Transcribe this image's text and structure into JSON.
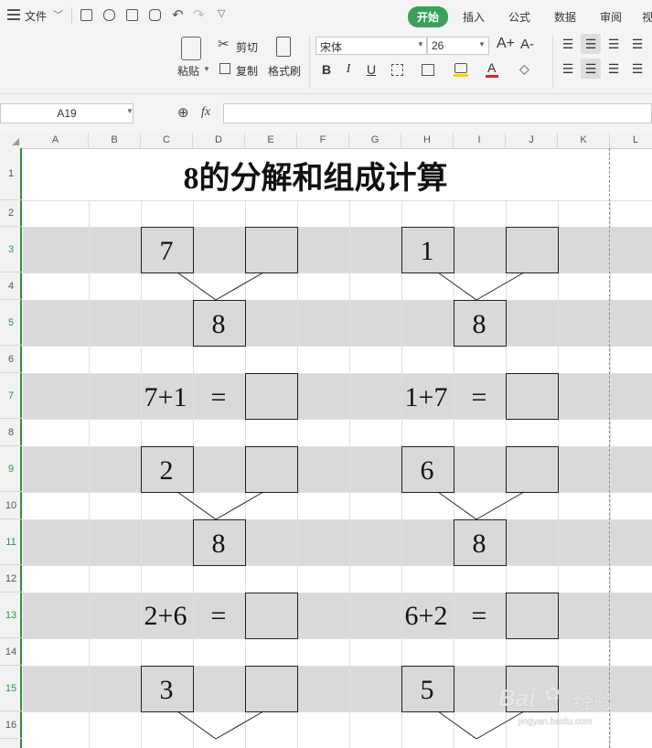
{
  "menu": {
    "file": "文件"
  },
  "tabs": {
    "home": "开始",
    "insert": "插入",
    "formula": "公式",
    "data": "数据",
    "review": "审阅",
    "view": "视"
  },
  "ribbon": {
    "paste": "粘贴",
    "cut": "剪切",
    "copy": "复制",
    "format_painter": "格式刷",
    "font_name": "宋体",
    "font_size": "26",
    "bold": "B",
    "italic": "I",
    "underline": "U",
    "grow_font": "A+",
    "shrink_font": "A-",
    "font_color_glyph": "A"
  },
  "formula_bar": {
    "cell_ref": "A19",
    "fx": "fx"
  },
  "columns": [
    "A",
    "B",
    "C",
    "D",
    "E",
    "F",
    "G",
    "H",
    "I",
    "J",
    "K",
    "L"
  ],
  "rows": [
    "1",
    "2",
    "3",
    "4",
    "5",
    "6",
    "7",
    "8",
    "9",
    "10",
    "11",
    "12",
    "13",
    "14",
    "15",
    "16"
  ],
  "sheet": {
    "title": "8的分解和组成计算",
    "left": {
      "block1": {
        "part": "7",
        "total": "8",
        "expr": "7+1",
        "eq": "="
      },
      "block2": {
        "part": "2",
        "total": "8",
        "expr": "2+6",
        "eq": "="
      },
      "block3": {
        "part": "3"
      }
    },
    "right": {
      "block1": {
        "part": "1",
        "total": "8",
        "expr": "1+7",
        "eq": "="
      },
      "block2": {
        "part": "6",
        "total": "8",
        "expr": "6+2",
        "eq": "="
      },
      "block3": {
        "part": "5"
      }
    }
  },
  "watermark": {
    "brand": "Bai",
    "suffix": "经验",
    "url": "jingyan.baidu.com"
  },
  "colors": {
    "accent": "#3aa15a",
    "band": "#d9d9d9",
    "selection": "#2f8f45"
  }
}
